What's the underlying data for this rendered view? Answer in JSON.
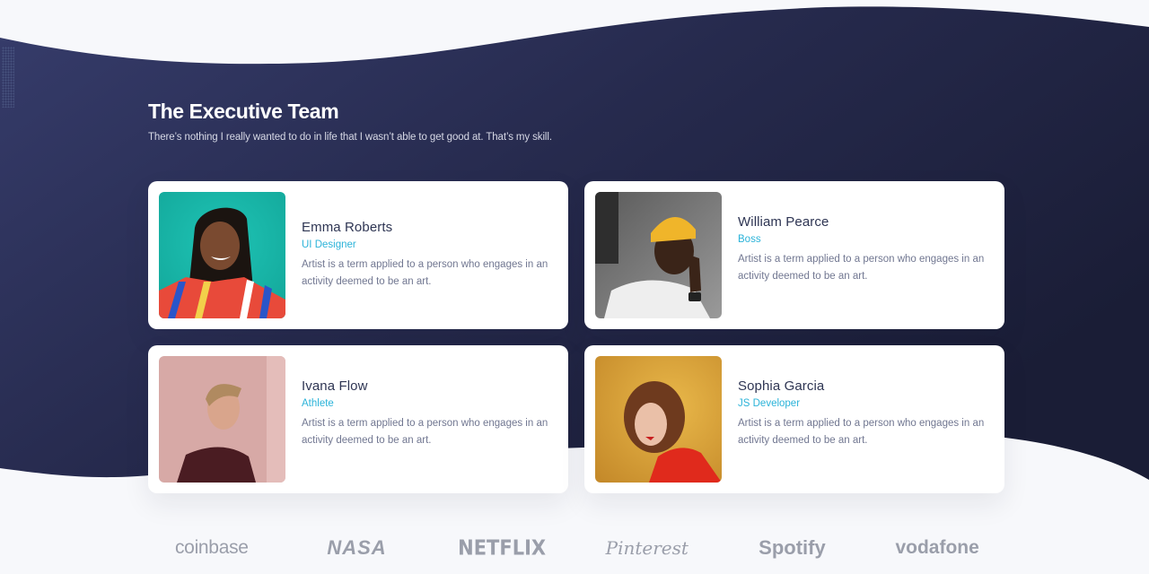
{
  "section": {
    "title": "The Executive Team",
    "subtitle": "There’s nothing I really wanted to do in life that I wasn’t able to get good at. That’s my skill."
  },
  "colors": {
    "background_dark": "#2a2f55",
    "background_light": "#f7f8fb",
    "accent": "#2bb3d9",
    "name_text": "#2e3553",
    "body_text": "#717791",
    "logo_gray": "#9a9eaa"
  },
  "team": [
    {
      "name": "Emma Roberts",
      "role": "UI Designer",
      "bio": "Artist is a term applied to a person who engages in an activity deemed to be an art.",
      "photo": "portrait-woman-braids-teal-background"
    },
    {
      "name": "William Pearce",
      "role": "Boss",
      "bio": "Artist is a term applied to a person who engages in an activity deemed to be an art.",
      "photo": "portrait-man-yellow-beanie"
    },
    {
      "name": "Ivana Flow",
      "role": "Athlete",
      "bio": "Artist is a term applied to a person who engages in an activity deemed to be an art.",
      "photo": "portrait-man-pink-wall"
    },
    {
      "name": "Sophia Garcia",
      "role": "JS Developer",
      "bio": "Artist is a term applied to a person who engages in an activity deemed to be an art.",
      "photo": "portrait-woman-red-shirt-yellow-background"
    }
  ],
  "logos": [
    "coinbase",
    "NASA",
    "NETFLIX",
    "Pinterest",
    "Spotify",
    "vodafone"
  ]
}
